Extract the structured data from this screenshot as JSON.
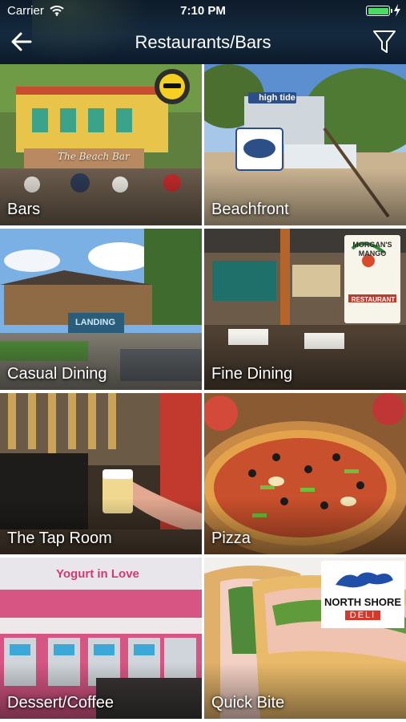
{
  "status_bar": {
    "carrier": "Carrier",
    "time": "7:10 PM"
  },
  "header": {
    "title": "Restaurants/Bars"
  },
  "categories": [
    {
      "label": "Bars",
      "image_text": "The Beach Bar"
    },
    {
      "label": "Beachfront",
      "image_text": "high tide"
    },
    {
      "label": "Casual Dining",
      "image_text": "LANDING"
    },
    {
      "label": "Fine Dining",
      "image_text": "MORGAN'S MANGO",
      "image_subtext": "RESTAURANT"
    },
    {
      "label": "The Tap Room"
    },
    {
      "label": "Pizza"
    },
    {
      "label": "Dessert/Coffee",
      "image_text": "Yogurt in Love"
    },
    {
      "label": "Quick Bite",
      "image_text": "NORTH SHORE",
      "image_subtext": "DELI"
    }
  ],
  "colors": {
    "header_bg": "#12243a",
    "text": "#ffffff",
    "battery": "#4cd964"
  }
}
